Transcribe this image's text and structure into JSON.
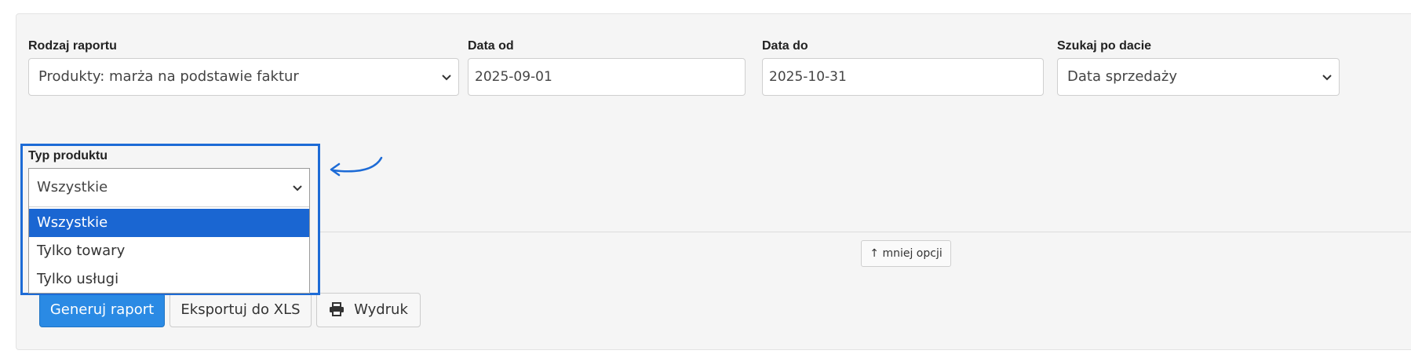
{
  "filters": {
    "report_type": {
      "label": "Rodzaj raportu",
      "value": "Produkty: marża na podstawie faktur"
    },
    "date_from": {
      "label": "Data od",
      "value": "2025-09-01"
    },
    "date_to": {
      "label": "Data do",
      "value": "2025-10-31"
    },
    "search_by_date": {
      "label": "Szukaj po dacie",
      "value": "Data sprzedaży"
    }
  },
  "product_type": {
    "label": "Typ produktu",
    "value": "Wszystkie",
    "options": [
      "Wszystkie",
      "Tylko towary",
      "Tylko usługi"
    ],
    "selected_index": 0
  },
  "less_options_label": "↑ mniej opcji",
  "actions": {
    "generate": "Generuj raport",
    "export": "Eksportuj do XLS",
    "print": "Wydruk"
  },
  "icons": {
    "select_chevron": "chevron-down-icon",
    "print": "printer-icon",
    "callout": "curved-arrow-icon"
  },
  "colors": {
    "primary": "#2a8ae4",
    "highlight_border": "#1d6bd6",
    "selected_option": "#1a66d2"
  }
}
